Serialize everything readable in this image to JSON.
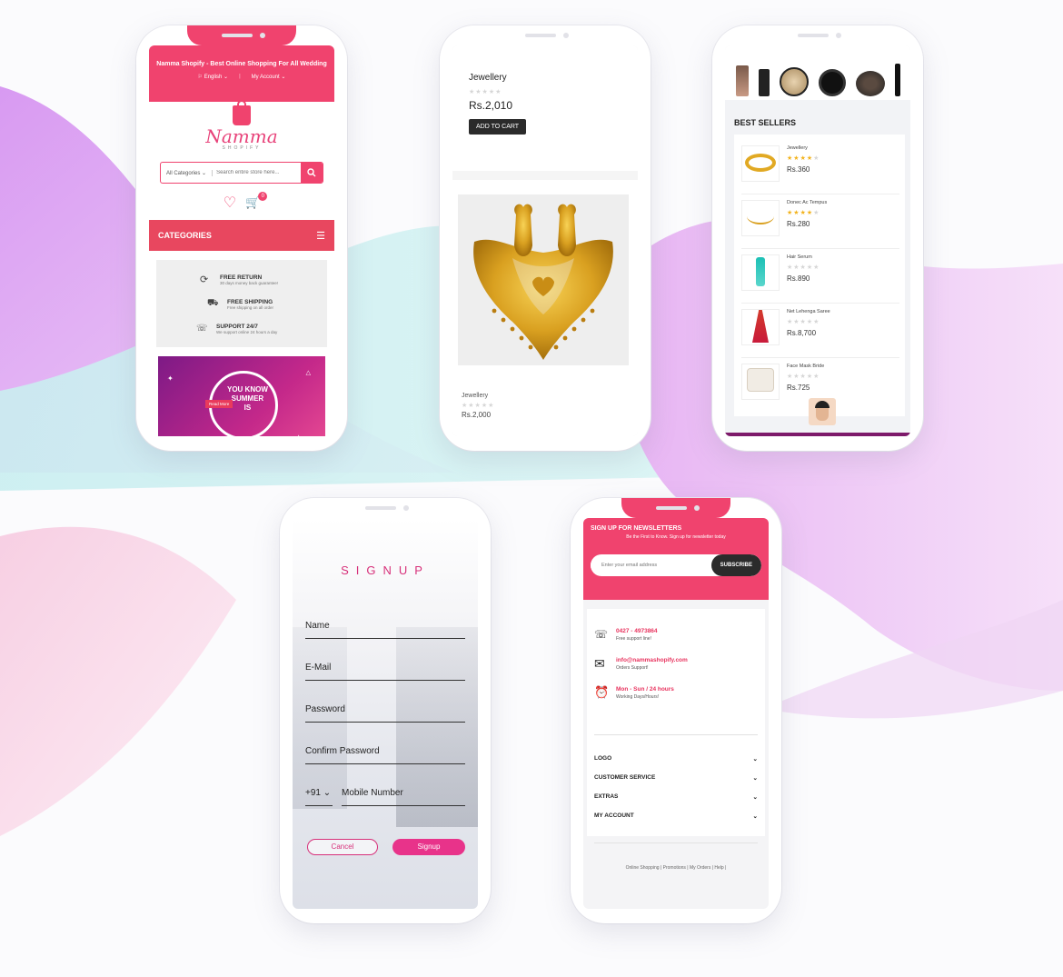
{
  "p1": {
    "banner_text": "Namma Shopify - Best Online Shopping For All Wedding",
    "lang": "English",
    "account": "My Account",
    "logo_title": "Namma",
    "logo_sub": "SHOPIFY",
    "categories_select": "All Categories",
    "search_placeholder": "Search entire store here...",
    "cart_count": "0",
    "categories_header": "CATEGORIES",
    "features": [
      {
        "title": "FREE RETURN",
        "desc": "30 days money back guarantee!"
      },
      {
        "title": "FREE SHIPPING",
        "desc": "Free shipping on all order"
      },
      {
        "title": "SUPPORT 24/7",
        "desc": "We support online 24 hours a day"
      }
    ],
    "promo_line1": "YOU KNOW",
    "promo_line2": "SUMMER",
    "promo_line3": "IS",
    "promo_btn": "Read More"
  },
  "p2": {
    "title": "Jewellery",
    "price": "Rs.2,010",
    "add_to_cart": "ADD TO CART",
    "card_name": "Jewellery",
    "card_price": "Rs.2,000"
  },
  "p3": {
    "section_title": "BEST SELLERS",
    "items": [
      {
        "name": "Jewellery",
        "price": "Rs.360",
        "rating": 4
      },
      {
        "name": "Donec Ac Tempus",
        "price": "Rs.280",
        "rating": 4
      },
      {
        "name": "Hair Serum",
        "price": "Rs.890",
        "rating": 0
      },
      {
        "name": "Net Lehenga Saree",
        "price": "Rs.8,700",
        "rating": 0
      },
      {
        "name": "Face Mask Bride",
        "price": "Rs.725",
        "rating": 0
      }
    ]
  },
  "p4": {
    "title": "SIGNUP",
    "fields": [
      "Name",
      "E-Mail",
      "Password",
      "Confirm Password"
    ],
    "country_code": "+91",
    "mobile": "Mobile Number",
    "cancel": "Cancel",
    "signup": "Signup"
  },
  "p5": {
    "newsletter_title": "SIGN UP FOR NEWSLETTERS",
    "newsletter_sub": "Be the First to Know. Sign up for newsletter today",
    "email_placeholder": "Enter your email address",
    "subscribe": "SUBSCRIBE",
    "contacts": [
      {
        "value": "0427 - 4973864",
        "label": "Free support line!"
      },
      {
        "value": "info@nammashopify.com",
        "label": "Orders Support!"
      },
      {
        "value": "Mon - Sun / 24 hours",
        "label": "Working Days/Hours!"
      }
    ],
    "menu": [
      "LOGO",
      "CUSTOMER SERVICE",
      "EXTRAS",
      "MY ACCOUNT"
    ],
    "footer_links": [
      "Online Shopping",
      "Promotions",
      "My Orders",
      "Help"
    ]
  },
  "colors": {
    "accent": "#f0436e",
    "categories_bar": "#e8475f",
    "dark_button": "#2b2b2b"
  }
}
